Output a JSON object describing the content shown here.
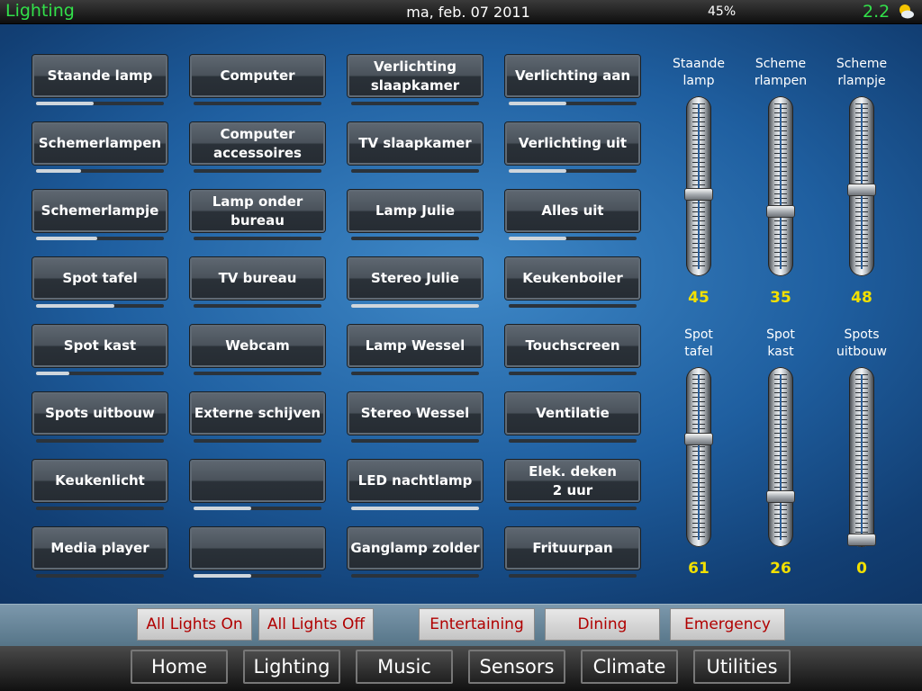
{
  "header": {
    "app_title": "Lighting",
    "date": "ma, feb. 07 2011",
    "battery": "45%",
    "version": "2.2",
    "weather_icon": "partly-sunny-icon"
  },
  "light_buttons": [
    [
      {
        "label": "Staande lamp",
        "level": 0.45
      },
      {
        "label": "Schemerlampen",
        "level": 0.35
      },
      {
        "label": "Schemerlampje",
        "level": 0.48
      },
      {
        "label": "Spot tafel",
        "level": 0.61
      },
      {
        "label": "Spot kast",
        "level": 0.26
      },
      {
        "label": "Spots uitbouw",
        "level": 0
      },
      {
        "label": "Keukenlicht",
        "level": 0
      },
      {
        "label": "Media player",
        "level": 0
      }
    ],
    [
      {
        "label": "Computer",
        "level": 0
      },
      {
        "label": "Computer\naccessoires",
        "level": 0
      },
      {
        "label": "Lamp onder\nbureau",
        "level": 0
      },
      {
        "label": "TV bureau",
        "level": 0
      },
      {
        "label": "Webcam",
        "level": 0
      },
      {
        "label": "Externe schijven",
        "level": 0
      },
      {
        "label": "",
        "level": 0.45
      },
      {
        "label": "",
        "level": 0.45
      }
    ],
    [
      {
        "label": "Verlichting\nslaapkamer",
        "level": 0
      },
      {
        "label": "TV slaapkamer",
        "level": 0
      },
      {
        "label": "Lamp Julie",
        "level": 0
      },
      {
        "label": "Stereo Julie",
        "level": 1
      },
      {
        "label": "Lamp Wessel",
        "level": 0
      },
      {
        "label": "Stereo Wessel",
        "level": 0
      },
      {
        "label": "LED nachtlamp",
        "level": 1
      },
      {
        "label": "Ganglamp zolder",
        "level": 0
      }
    ],
    [
      {
        "label": "Verlichting aan",
        "level": 0.45
      },
      {
        "label": "Verlichting uit",
        "level": 0.45
      },
      {
        "label": "Alles uit",
        "level": 0.45
      },
      {
        "label": "Keukenboiler",
        "level": 0
      },
      {
        "label": "Touchscreen",
        "level": 0
      },
      {
        "label": "Ventilatie",
        "level": 0
      },
      {
        "label": "Elek. deken\n2 uur",
        "level": 0
      },
      {
        "label": "Frituurpan",
        "level": 0
      }
    ]
  ],
  "dimmers": [
    {
      "label": "Staande\nlamp",
      "value": 45
    },
    {
      "label": "Scheme\nrlampen",
      "value": 35
    },
    {
      "label": "Scheme\nrlampje",
      "value": 48
    },
    {
      "label": "Spot\ntafel",
      "value": 61
    },
    {
      "label": "Spot\nkast",
      "value": 26
    },
    {
      "label": "Spots\nuitbouw",
      "value": 0
    }
  ],
  "scenes": [
    "All Lights On",
    "All Lights Off",
    "Entertaining",
    "Dining",
    "Emergency"
  ],
  "nav": [
    "Home",
    "Lighting",
    "Music",
    "Sensors",
    "Climate",
    "Utilities"
  ],
  "colors": {
    "value_text": "#f2e000",
    "scene_text": "#b00000",
    "title_green": "#32e04a"
  }
}
